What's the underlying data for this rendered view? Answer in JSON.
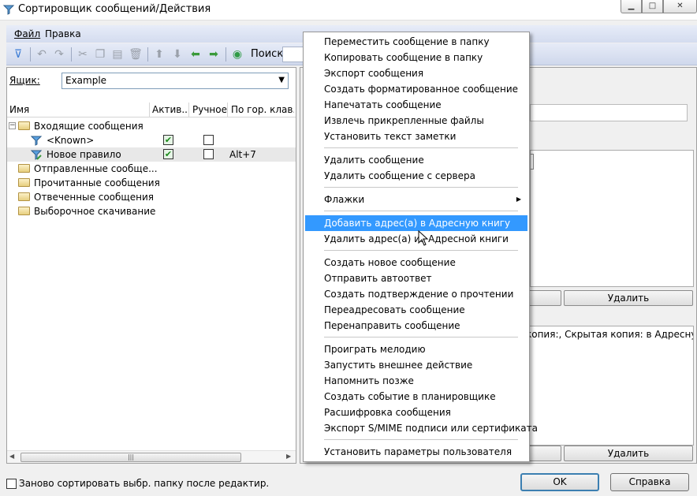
{
  "window": {
    "title": "Сортировщик сообщений/Действия"
  },
  "menubar": {
    "file": "Файл",
    "edit": "Правка"
  },
  "toolbar": {
    "search_label": "Поиск"
  },
  "mailbox": {
    "label": "Ящик:",
    "value": "Example"
  },
  "columns": [
    "Имя",
    "Актив...",
    "Ручное",
    "По гор. клав."
  ],
  "tree": {
    "inbox": "Входящие сообщения",
    "known_rule": "<Known>",
    "new_rule": "Новое правило",
    "new_rule_hotkey": "Alt+7",
    "sent": "Отправленные сообще...",
    "read": "Прочитанные сообщения",
    "replied": "Отвеченные сообщения",
    "selective": "Выборочное скачивание"
  },
  "right_panel": {
    "delete_label_1": "Удалить",
    "delete_label_2": "Удалить",
    "area_text": "копия:, Скрытая копия: в Адресную кни"
  },
  "bottom": {
    "resort_label": "Заново сортировать выбр. папку после редактир.",
    "ok": "OK",
    "help": "Справка"
  },
  "context_menu": {
    "group1": [
      "Переместить сообщение в папку",
      "Копировать сообщение в папку",
      "Экспорт сообщения",
      "Создать форматированное сообщение",
      "Напечатать сообщение",
      "Извлечь прикрепленные файлы",
      "Установить текст заметки"
    ],
    "group2": [
      "Удалить сообщение",
      "Удалить сообщение с сервера"
    ],
    "group3": [
      "Флажки"
    ],
    "group4": [
      "Добавить адрес(а) в Адресную книгу",
      "Удалить адрес(а) из Адресной книги"
    ],
    "group5": [
      "Создать новое сообщение",
      "Отправить автоответ",
      "Создать подтверждение о прочтении",
      "Переадресовать сообщение",
      "Перенаправить сообщение"
    ],
    "group6": [
      "Проиграть мелодию",
      "Запустить внешнее действие",
      "Напомнить позже",
      "Создать событие в планировщике",
      "Расшифровка сообщения",
      "Экспорт S/MIME подписи или сертификата"
    ],
    "group7": [
      "Установить параметры пользователя"
    ]
  },
  "colors": {
    "highlight": "#3399ff",
    "accent_border": "#3c7fb1"
  }
}
